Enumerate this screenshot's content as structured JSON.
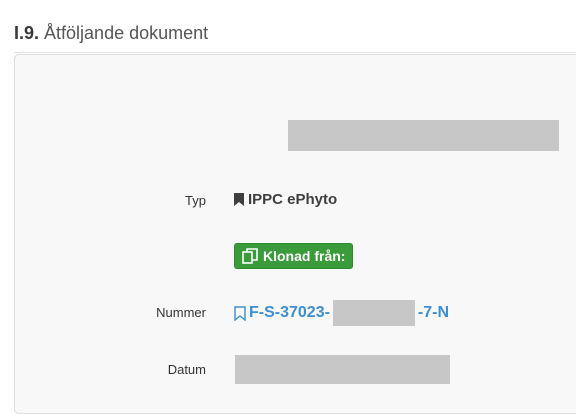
{
  "section": {
    "number": "I.9.",
    "title": "Åtföljande dokument"
  },
  "fields": {
    "type_label": "Typ",
    "type_value": "IPPC ePhyto",
    "cloned_badge": "Klonad från:",
    "number_label": "Nummer",
    "number_prefix": "F-S-37023-",
    "number_suffix": "-7-N",
    "date_label": "Datum"
  },
  "icons": {
    "type": "bookmark-filled-icon",
    "cloned": "copy-icon",
    "number": "bookmark-outline-icon"
  },
  "colors": {
    "link": "#3a8fd6",
    "badge_green": "#3a9b3a",
    "redaction": "#c7c7c7"
  }
}
